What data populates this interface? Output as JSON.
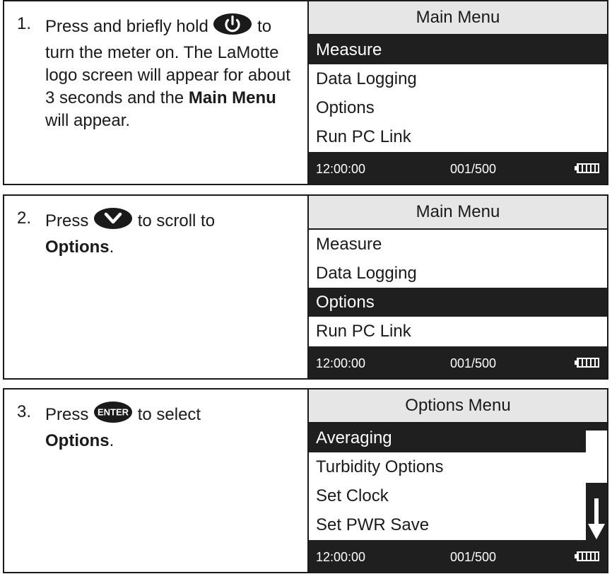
{
  "step1": {
    "number": "1.",
    "text_before_icon": "Press and briefly hold",
    "power_icon": "power-icon",
    "text_after_icon": "to turn the meter on. The LaMotte logo screen will appear for about 3 seconds and the",
    "bold_phrase": "Main Menu",
    "text_end": "will appear.",
    "screen": {
      "title": "Main Menu",
      "items": [
        "Measure",
        "Data Logging",
        "Options",
        "Run PC Link"
      ],
      "selected_index": 0,
      "time": "12:00:00",
      "count": "001/500",
      "battery_icon": "battery-icon"
    }
  },
  "step2": {
    "number": "2.",
    "text_before_icon": "Press",
    "down_icon": "chevron-down-icon",
    "text_after_icon": "to scroll to",
    "bold_phrase": "Options",
    "text_end": ".",
    "screen": {
      "title": "Main Menu",
      "items": [
        "Measure",
        "Data Logging",
        "Options",
        "Run PC Link"
      ],
      "selected_index": 2,
      "time": "12:00:00",
      "count": "001/500",
      "battery_icon": "battery-icon"
    }
  },
  "step3": {
    "number": "3.",
    "text_before_icon": "Press",
    "enter_icon": "enter-key-icon",
    "enter_label": "ENTER",
    "text_after_icon": "to select",
    "bold_phrase": "Options",
    "text_end": ".",
    "screen": {
      "title": "Options Menu",
      "items": [
        "Averaging",
        "Turbidity Options",
        "Set Clock",
        "Set PWR Save"
      ],
      "selected_index": 0,
      "time": "12:00:00",
      "count": "001/500",
      "battery_icon": "battery-icon",
      "scroll_icon": "scroll-down-arrow-icon"
    }
  }
}
